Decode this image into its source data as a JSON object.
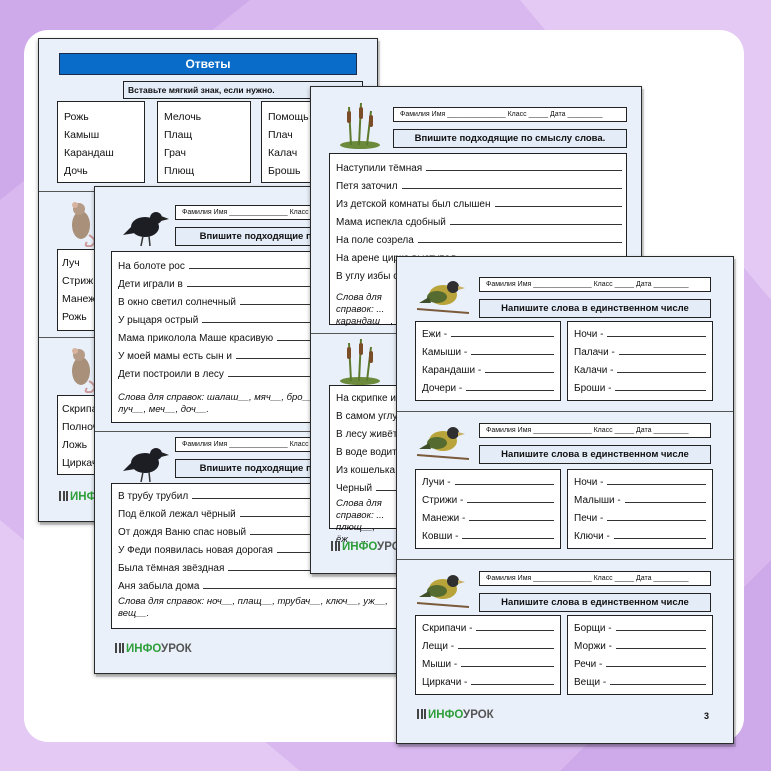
{
  "answers": {
    "title": "Ответы",
    "task": "Вставьте мягкий знак, если нужно.",
    "col1": [
      "Рожь",
      "Камыш",
      "Карандаш",
      "Дочь"
    ],
    "col2": [
      "Мелочь",
      "Плащ",
      "Грач",
      "Плющ"
    ],
    "col3": [
      "Помощь",
      "Плач",
      "Калач",
      "Брошь"
    ],
    "col4a": [
      "Луч",
      "Стриж",
      "Манеж",
      "Рожь"
    ],
    "col4b": [
      "Скрипач",
      "Полноч",
      "Ложь",
      "Циркач"
    ]
  },
  "header": {
    "fields": "Фамилия Имя _______________ Класс _____ Дата _________"
  },
  "sheet2": {
    "task1": "Впишите подходящие по смыслу слова.",
    "lines1": [
      "На болоте рос",
      "Дети играли в",
      "В окно светил солнечный",
      "У рыцаря острый",
      "Мама приколола Маше красивую",
      "У моей мамы есть сын и",
      "Дети построили в лесу"
    ],
    "hint1": "Слова для справок: шалаш__, мяч__, бро__, луч__, меч__, доч__.",
    "lines2": [
      "В трубу трубил",
      "Под ёлкой лежал чёрный",
      "От дождя Ваню спас новый",
      "У Феди появилась новая дорогая",
      "Была тёмная звёздная",
      "Аня забыла дома"
    ],
    "hint2": "Слова для справок: ноч__, плащ__, трубач__, ключ__, уж__, вещ__."
  },
  "sheet3": {
    "task": "Впишите подходящие по смыслу слова.",
    "lines1": [
      "Наступили тёмная",
      "Петя заточил",
      "Из детской комнаты был слышен",
      "Мама испекла сдобный",
      "На поле созрела",
      "На арене цирка выступал",
      "В углу избы стоял"
    ],
    "hint1": "Слова для справок: ... карандаш__, ...",
    "lines2": [
      "На скрипке играл",
      "В самом углу",
      "В лесу живёт",
      "В воде водится",
      "Из кошелька",
      "Черный"
    ],
    "hint2": "Слова для справок: ... плющ__, ёж__ ..."
  },
  "sheet4": {
    "task": "Напишите слова в единственном числе",
    "s1_left": [
      "Ежи -",
      "Камыши -",
      "Карандаши -",
      "Дочери -"
    ],
    "s1_right": [
      "Ночи -",
      "Палачи -",
      "Калачи -",
      "Броши -"
    ],
    "s2_left": [
      "Лучи -",
      "Стрижи -",
      "Манежи -",
      "Ковши -"
    ],
    "s2_right": [
      "Ночи -",
      "Малыши -",
      "Печи -",
      "Ключи -"
    ],
    "s3_left": [
      "Скрипачи -",
      "Лещи -",
      "Мыши -",
      "Циркачи -"
    ],
    "s3_right": [
      "Борщи -",
      "Моржи -",
      "Речи -",
      "Вещи -"
    ],
    "page": "3"
  },
  "logo": {
    "part1": "ИНФО",
    "part2": "УРОК"
  },
  "colors": {
    "accent": "#0a6cc9",
    "background": "#d8b8ee",
    "sheet": "#e9f0fa",
    "logo_green": "#2e9e3a"
  }
}
